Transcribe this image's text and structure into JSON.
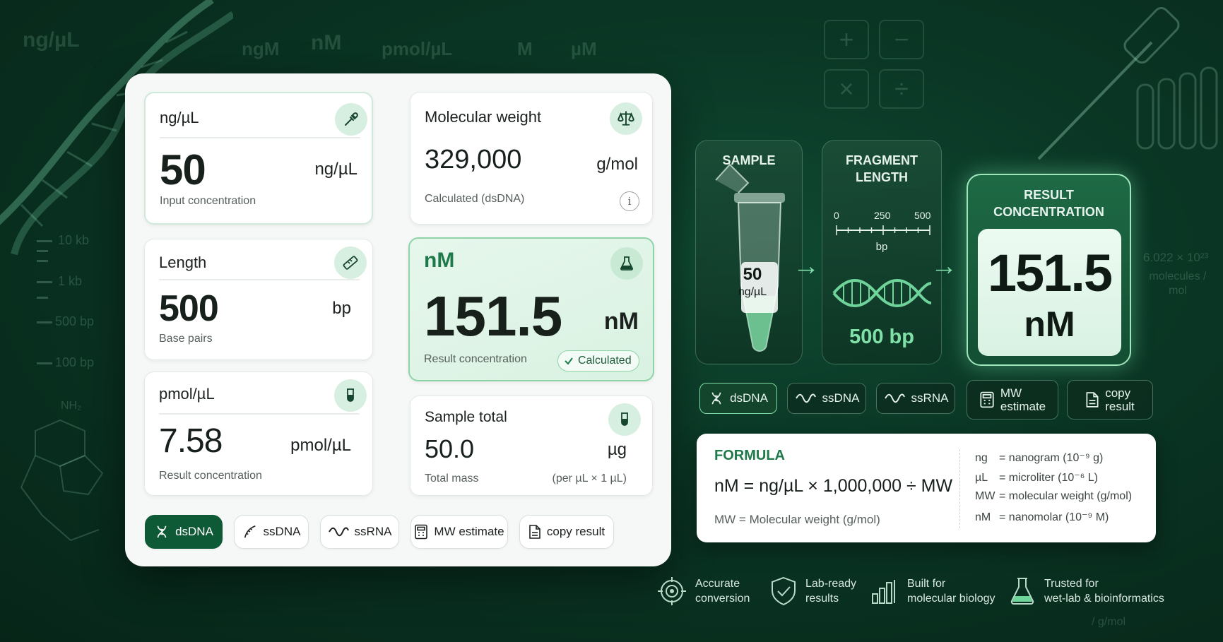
{
  "background": {
    "unit_labels": [
      "ng/µL",
      "ngM",
      "nM",
      "pmol/µL",
      "M",
      "µM"
    ],
    "ladder_labels": [
      "10 kb",
      "1 kb",
      "500 bp",
      "100 bp"
    ],
    "nh2_label": "NH₂",
    "avogadro": "6.022 × 10²³",
    "avogadro_unit": "molecules / mol",
    "bottom_faint": "/ g/mol",
    "calc_keys": [
      "+",
      "−",
      "×",
      "÷"
    ]
  },
  "cards": {
    "ngul": {
      "title": "ng/µL",
      "value": "50",
      "unit": "ng/µL",
      "sub": "Input concentration",
      "icon": "pipette-icon"
    },
    "mw": {
      "title": "Molecular weight",
      "value": "329,000",
      "unit": "g/mol",
      "sub": "Calculated (dsDNA)",
      "info": "i",
      "icon": "scale-icon"
    },
    "length": {
      "title": "Length",
      "value": "500",
      "unit": "bp",
      "sub": "Base pairs",
      "icon": "ruler-icon"
    },
    "nm": {
      "title": "nM",
      "value": "151.5",
      "unit": "nM",
      "sub": "Result concentration",
      "badge": "Calculated",
      "icon": "flask-icon"
    },
    "pmol": {
      "title": "pmol/µL",
      "value": "7.58",
      "unit": "pmol/µL",
      "sub": "Result concentration",
      "icon": "tube-icon"
    },
    "total": {
      "title": "Sample total",
      "value": "50.0",
      "unit": "µg",
      "sub": "Total mass",
      "note": "(per µL × 1 µL)",
      "icon": "tube-icon"
    }
  },
  "panel_chips": [
    {
      "label": "dsDNA",
      "icon": "dna-icon",
      "active": true
    },
    {
      "label": "ssDNA",
      "icon": "strand-icon",
      "active": false
    },
    {
      "label": "ssRNA",
      "icon": "wave-icon",
      "active": false
    },
    {
      "label": "MW estimate",
      "icon": "calculator-icon",
      "active": false
    },
    {
      "label": "copy result",
      "icon": "document-icon",
      "active": false
    }
  ],
  "flow": {
    "sample_title": "SAMPLE",
    "tube_value": "50",
    "tube_unit": "ng/µL",
    "fragment_title_1": "FRAGMENT",
    "fragment_title_2": "LENGTH",
    "scale": [
      "0",
      "250",
      "500"
    ],
    "scale_unit": "bp",
    "fragment_value": "500 bp",
    "result_title_1": "RESULT",
    "result_title_2": "CONCENTRATION",
    "result_value": "151.5",
    "result_unit": "nM"
  },
  "flow_chips": [
    {
      "label": "dsDNA",
      "icon": "dna-icon",
      "active": true
    },
    {
      "label": "ssDNA",
      "icon": "wave-icon",
      "active": false
    },
    {
      "label": "ssRNA",
      "icon": "wave-icon",
      "active": false
    },
    {
      "label_1": "MW",
      "label_2": "estimate",
      "icon": "calculator-icon"
    },
    {
      "label_1": "copy",
      "label_2": "result",
      "icon": "document-icon"
    }
  ],
  "formula": {
    "title": "FORMULA",
    "equation": "nM = ng/µL × 1,000,000 ÷ MW",
    "note": "MW = Molecular weight (g/mol)",
    "legend": [
      {
        "k": "ng",
        "v": "= nanogram (10⁻⁹ g)"
      },
      {
        "k": "µL",
        "v": "= microliter (10⁻⁶ L)"
      },
      {
        "k": "MW",
        "v": "= molecular weight (g/mol)"
      },
      {
        "k": "nM",
        "v": "= nanomolar (10⁻⁹ M)"
      }
    ]
  },
  "features": [
    {
      "line_1": "Accurate",
      "line_2": "conversion",
      "icon": "target-icon"
    },
    {
      "line_1": "Lab-ready",
      "line_2": "results",
      "icon": "shield-check-icon"
    },
    {
      "line_1": "Built for",
      "line_2": "molecular biology",
      "icon": "bar-chart-icon"
    },
    {
      "line_1": "Trusted for",
      "line_2": "wet-lab & bioinformatics",
      "icon": "flask-icon"
    }
  ],
  "colors": {
    "brand_dark": "#0f5a36",
    "accent": "#1e7a4a",
    "glow": "#7fdca8",
    "background": "#0a3524"
  }
}
